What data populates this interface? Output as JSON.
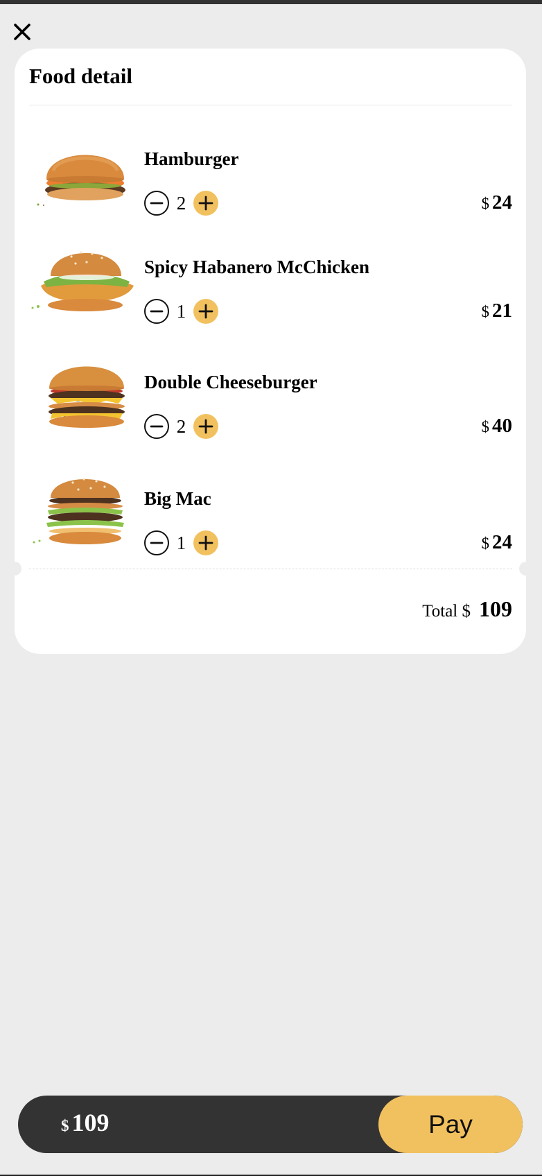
{
  "header": {
    "close_icon": "close-icon"
  },
  "card": {
    "title": "Food detail"
  },
  "items": [
    {
      "name": "Hamburger",
      "quantity": "2",
      "currency": "$",
      "price": "24",
      "image": "hamburger"
    },
    {
      "name": "Spicy Habanero McChicken",
      "quantity": "1",
      "currency": "$",
      "price": "21",
      "image": "spicy-chicken-sandwich"
    },
    {
      "name": "Double Cheeseburger",
      "quantity": "2",
      "currency": "$",
      "price": "40",
      "image": "double-cheeseburger"
    },
    {
      "name": "Big Mac",
      "quantity": "1",
      "currency": "$",
      "price": "24",
      "image": "big-mac"
    }
  ],
  "summary": {
    "total_label": "Total $",
    "total_value": "109"
  },
  "paybar": {
    "currency": "$",
    "amount": "109",
    "pay_label": "Pay"
  },
  "colors": {
    "accent": "#f2c15f",
    "paybar_bg": "#333333",
    "page_bg": "#ececec"
  }
}
